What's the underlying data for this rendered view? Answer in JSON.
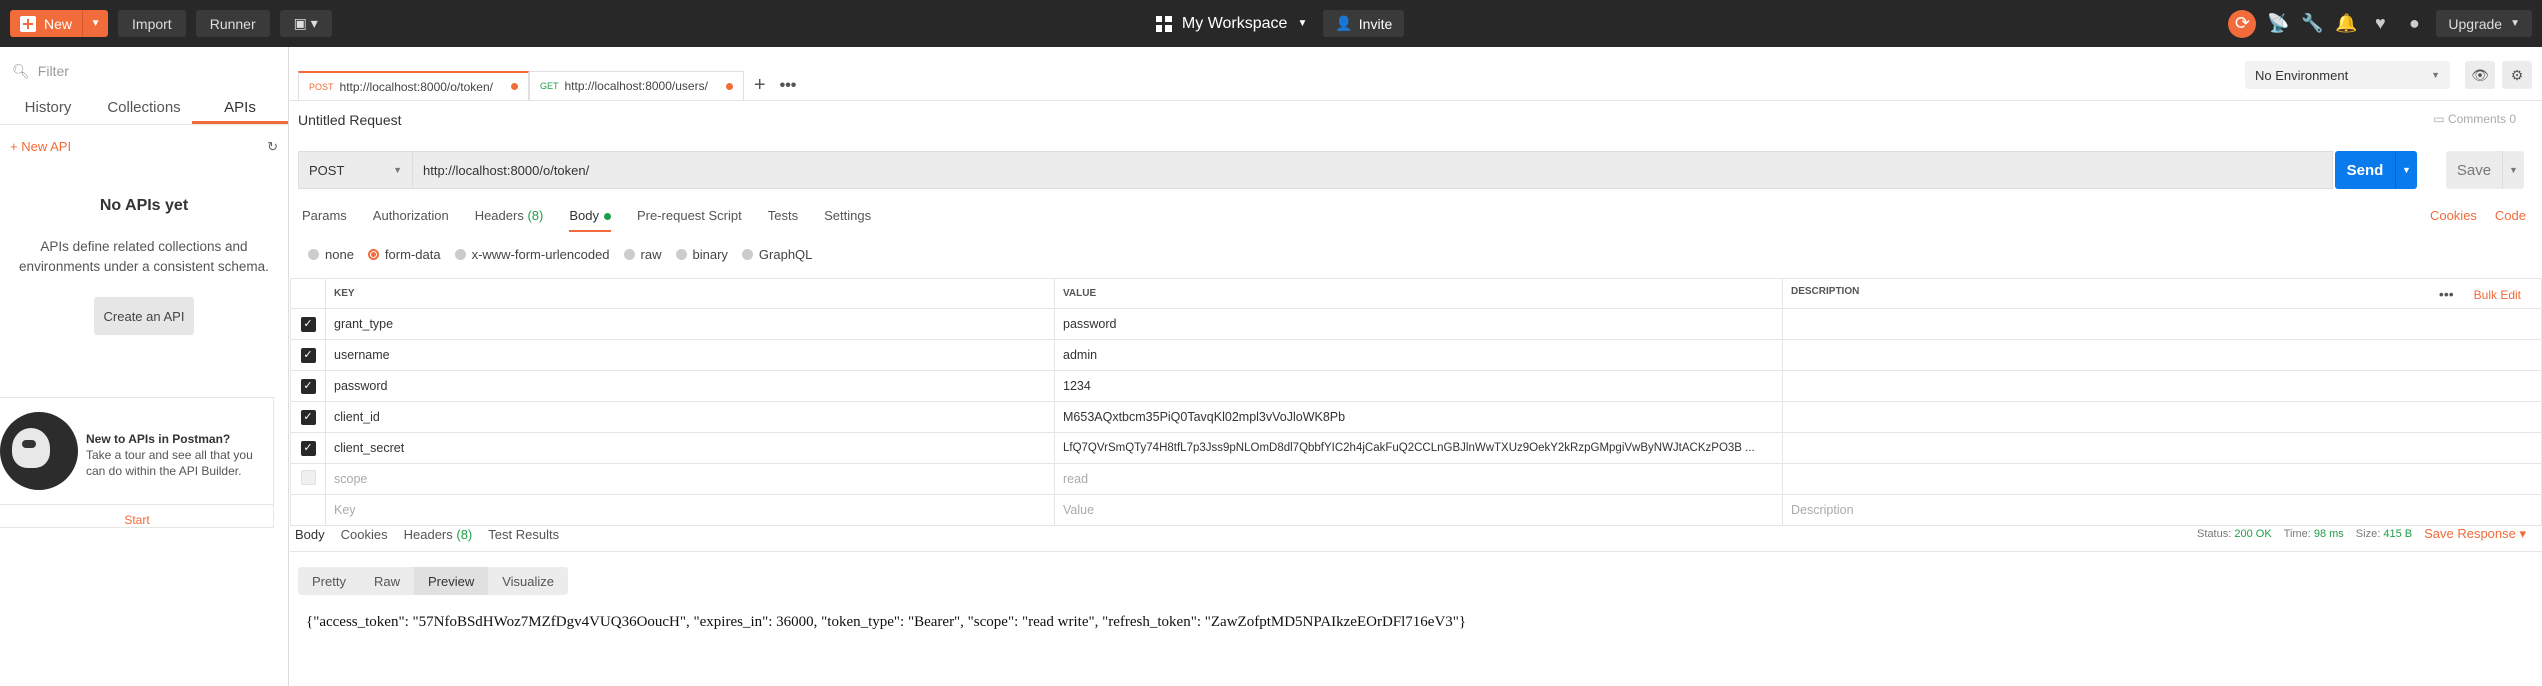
{
  "topbar": {
    "new_label": "New",
    "import_label": "Import",
    "runner_label": "Runner",
    "workspace": "My Workspace",
    "invite_label": "Invite",
    "upgrade_label": "Upgrade"
  },
  "sidebar": {
    "filter_placeholder": "Filter",
    "tabs": [
      "History",
      "Collections",
      "APIs"
    ],
    "new_api_label": "New API",
    "empty_title": "No APIs yet",
    "empty_desc": "APIs define related collections and environments under a consistent schema.",
    "create_label": "Create an API",
    "promo_title": "New to APIs in Postman?",
    "promo_desc": "Take a tour and see all that you can do within the API Builder.",
    "start_label": "Start"
  },
  "tabs": [
    {
      "method": "POST",
      "url": "http://localhost:8000/o/token/"
    },
    {
      "method": "GET",
      "url": "http://localhost:8000/users/"
    }
  ],
  "environment": "No Environment",
  "request": {
    "title": "Untitled Request",
    "comments_label": "Comments",
    "comments_count": "0",
    "method": "POST",
    "url": "http://localhost:8000/o/token/",
    "send_label": "Send",
    "save_label": "Save"
  },
  "param_tabs": {
    "params": "Params",
    "authorization": "Authorization",
    "headers": "Headers",
    "headers_count": "(8)",
    "body": "Body",
    "prerequest": "Pre-request Script",
    "tests": "Tests",
    "settings": "Settings",
    "cookies": "Cookies",
    "code": "Code"
  },
  "body_types": [
    "none",
    "form-data",
    "x-www-form-urlencoded",
    "raw",
    "binary",
    "GraphQL"
  ],
  "table": {
    "headers": {
      "key": "KEY",
      "value": "VALUE",
      "description": "DESCRIPTION",
      "bulk": "Bulk Edit"
    },
    "rows": [
      {
        "key": "grant_type",
        "value": "password"
      },
      {
        "key": "username",
        "value": "admin"
      },
      {
        "key": "password",
        "value": "1234"
      },
      {
        "key": "client_id",
        "value": "M653AQxtbcm35PiQ0TavqKl02mpl3vVoJloWK8Pb"
      },
      {
        "key": "client_secret",
        "value": "LfQ7QVrSmQTy74H8tfL7p3Jss9pNLOmD8dl7QbbfYIC2h4jCakFuQ2CCLnGBJlnWwTXUz9OekY2kRzpGMpgiVwByNWJtACKzPO3B ..."
      },
      {
        "key": "scope",
        "value": "read"
      }
    ],
    "placeholder_key": "Key",
    "placeholder_value": "Value",
    "placeholder_desc": "Description"
  },
  "response": {
    "tabs": {
      "body": "Body",
      "cookies": "Cookies",
      "headers": "Headers",
      "headers_count": "(8)",
      "tests": "Test Results"
    },
    "status_label": "Status:",
    "status": "200 OK",
    "time_label": "Time:",
    "time": "98 ms",
    "size_label": "Size:",
    "size": "415 B",
    "save_label": "Save Response",
    "views": [
      "Pretty",
      "Raw",
      "Preview",
      "Visualize"
    ],
    "body": "{\"access_token\": \"57NfoBSdHWoz7MZfDgv4VUQ36OoucH\", \"expires_in\": 36000, \"token_type\": \"Bearer\", \"scope\": \"read write\", \"refresh_token\": \"ZawZofptMD5NPAIkzeEOrDFl716eV3\"}"
  }
}
